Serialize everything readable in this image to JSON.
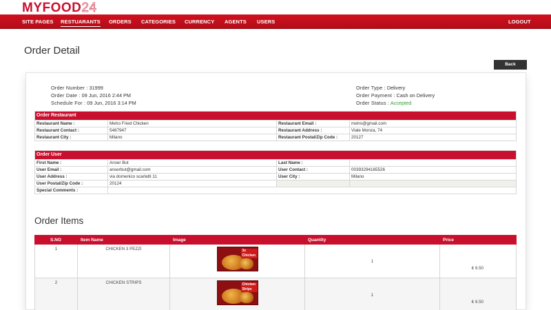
{
  "brand": {
    "logo_a": "MYFOOD",
    "logo_b": "24"
  },
  "nav": {
    "items": [
      "SITE PAGES",
      "RESTUARANTS",
      "ORDERS",
      "CATEGORIES",
      "CURRENCY",
      "AGENTS",
      "USERS"
    ],
    "logout": "LOGOUT",
    "active": "RESTUARANTS"
  },
  "page": {
    "title": "Order Detail",
    "back_label": "Back"
  },
  "order": {
    "number_label": "Order Number :",
    "number": "31999",
    "date_label": "Order Date :",
    "date": "09 Jun, 2016 2:44 PM",
    "schedule_label": "Schedule For :",
    "schedule": "09 Jun, 2016 3:14 PM",
    "type_label": "Order Type :",
    "type": "Delivery",
    "payment_label": "Order Payment :",
    "payment": "Cash on Delivery",
    "status_label": "Order Status :",
    "status": "Accepted",
    "status_color": "#2e9e2e"
  },
  "restaurant": {
    "heading": "Order Restaurant",
    "name_label": "Restaurant Name :",
    "name": "Metro Fried Chicken",
    "email_label": "Restaurant Email :",
    "email": "metro@gmail.com",
    "contact_label": "Restaurant Contact :",
    "contact": "5487947",
    "address_label": "Restaurant Address :",
    "address": "Viale Monza, 74",
    "city_label": "Restaurant City :",
    "city": "Milano",
    "zip_label": "Restaurant Postal/Zip Code :",
    "zip": "20127"
  },
  "user": {
    "heading": "Order User",
    "first_label": "First Name :",
    "first": "Anser But",
    "last_label": "Last Name :",
    "last": "",
    "email_label": "User Email :",
    "email": "anserbut@gmail.com",
    "contact_label": "User Contact :",
    "contact": "00393294165526",
    "address_label": "User Address :",
    "address": "via domenico scarlatti 11",
    "city_label": "User City :",
    "city": "Milano",
    "zip_label": "User Postal/Zip Code :",
    "zip": "20124",
    "comments_label": "Special Comments :",
    "comments": ""
  },
  "items": {
    "title": "Order Items",
    "headers": [
      "S.NO",
      "Item Name",
      "Image",
      "Quantity",
      "Price"
    ],
    "rows": [
      {
        "sno": "1",
        "name": "CHICKEN 3 PEZZI",
        "image_badge": "3x Chicken",
        "quantity": "1",
        "price": "€ 6.50"
      },
      {
        "sno": "2",
        "name": "CHICKEN STRIPS",
        "image_badge": "Chicken Strips",
        "quantity": "1",
        "price": "€ 6.50"
      }
    ]
  },
  "colors": {
    "brand_red": "#c8102e",
    "nav_red": "#d1111f",
    "back_button": "#333333"
  }
}
